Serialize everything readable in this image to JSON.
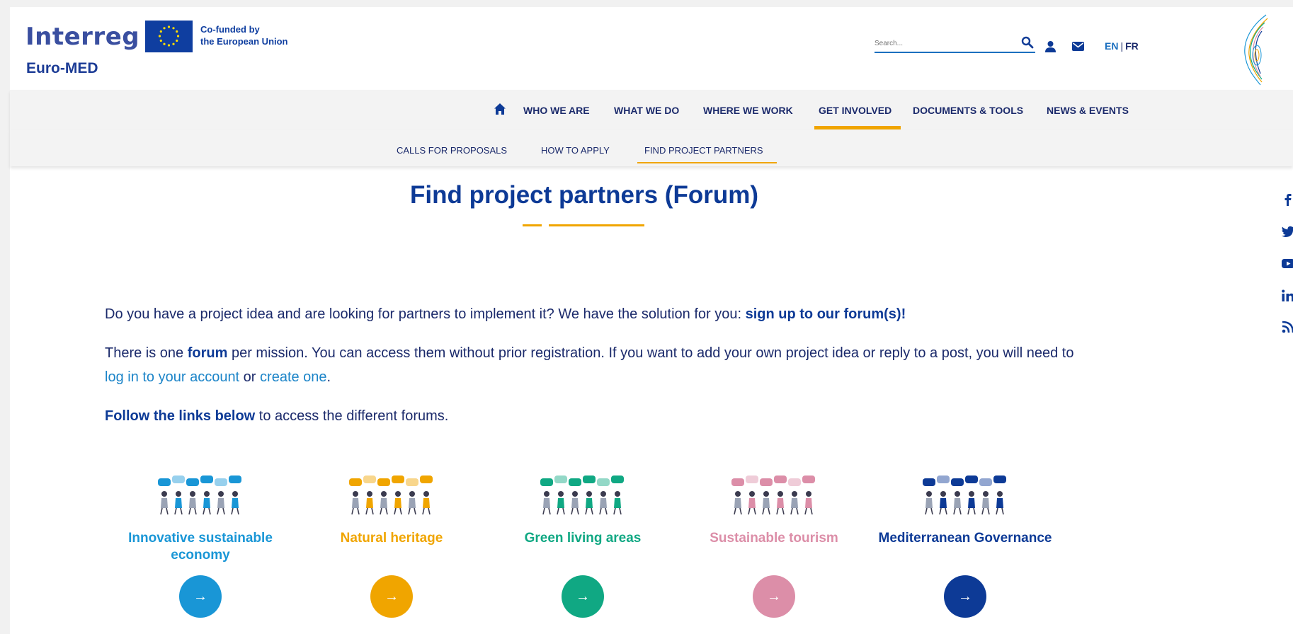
{
  "header": {
    "logo_main": "Interreg",
    "logo_cofund_line1": "Co-funded by",
    "logo_cofund_line2": "the European Union",
    "logo_sub": "Euro-MED",
    "search_placeholder": "Search...",
    "lang_en": "EN",
    "lang_sep": "|",
    "lang_fr": "FR"
  },
  "nav": {
    "items": [
      {
        "label": "WHO WE ARE"
      },
      {
        "label": "WHAT WE DO"
      },
      {
        "label": "WHERE WE WORK"
      },
      {
        "label": "GET INVOLVED",
        "active": true
      },
      {
        "label": "DOCUMENTS & TOOLS"
      },
      {
        "label": "NEWS & EVENTS"
      }
    ]
  },
  "subnav": {
    "items": [
      {
        "label": "CALLS FOR PROPOSALS"
      },
      {
        "label": "HOW TO APPLY"
      },
      {
        "label": "FIND PROJECT PARTNERS",
        "active": true
      }
    ]
  },
  "page": {
    "title": "Find project partners (Forum)",
    "p1_text": "Do you have a project idea and are looking for partners to implement it? We have the solution for you: ",
    "p1_bold": "sign up to our forum(s)!",
    "p2_a": "There is one ",
    "p2_bold": "forum",
    "p2_b": " per mission. You can access them without prior registration. If you want to add your own project idea or reply to a post, you will need to ",
    "p2_link1": "log in to your account",
    "p2_c": " or ",
    "p2_link2": "create one",
    "p2_d": ".",
    "p3_bold": "Follow the links below",
    "p3_text": " to access the different forums."
  },
  "forums": [
    {
      "title": "Innovative sustainable economy",
      "color": "#1996d6",
      "button": "→"
    },
    {
      "title": "Natural heritage",
      "color": "#f0a500",
      "button": "→"
    },
    {
      "title": "Green living areas",
      "color": "#10a883",
      "button": "→"
    },
    {
      "title": "Sustainable tourism",
      "color": "#dc8ea8",
      "button": "→"
    },
    {
      "title": "Mediterranean Governance",
      "color": "#0d3a96",
      "button": "→"
    }
  ],
  "social": [
    "facebook-icon",
    "twitter-icon",
    "youtube-icon",
    "linkedin-icon",
    "rss-icon"
  ],
  "colors": {
    "brand_blue": "#0d3a96",
    "accent_yellow": "#f0a500",
    "link_blue": "#1b84c8"
  }
}
